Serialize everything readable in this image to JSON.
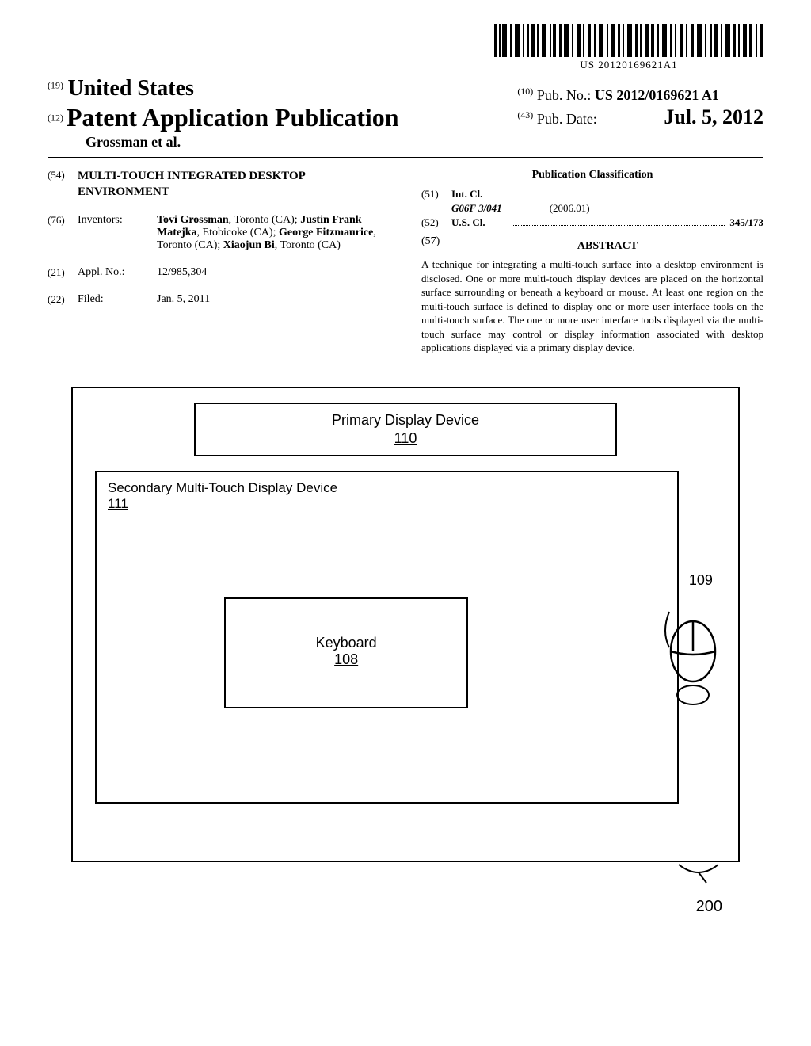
{
  "barcode_number": "US 20120169621A1",
  "header": {
    "country_code": "(19)",
    "country": "United States",
    "doc_type_code": "(12)",
    "doc_type": "Patent Application Publication",
    "authors_line": "Grossman et al.",
    "pub_no_code": "(10)",
    "pub_no_label": "Pub. No.:",
    "pub_no": "US 2012/0169621 A1",
    "pub_date_code": "(43)",
    "pub_date_label": "Pub. Date:",
    "pub_date": "Jul. 5, 2012"
  },
  "left": {
    "title_code": "(54)",
    "title": "MULTI-TOUCH INTEGRATED DESKTOP ENVIRONMENT",
    "inventors_code": "(76)",
    "inventors_label": "Inventors:",
    "inventors_html": "Tovi Grossman, Toronto (CA); Justin Frank Matejka, Etobicoke (CA); George Fitzmaurice, Toronto (CA); Xiaojun Bi, Toronto (CA)",
    "appl_code": "(21)",
    "appl_label": "Appl. No.:",
    "appl_no": "12/985,304",
    "filed_code": "(22)",
    "filed_label": "Filed:",
    "filed_date": "Jan. 5, 2011"
  },
  "right": {
    "classification_hdr": "Publication Classification",
    "intcl_code": "(51)",
    "intcl_label": "Int. Cl.",
    "intcl_class": "G06F 3/041",
    "intcl_date": "(2006.01)",
    "uscl_code": "(52)",
    "uscl_label": "U.S. Cl.",
    "uscl_val": "345/173",
    "abstract_code": "(57)",
    "abstract_hdr": "ABSTRACT",
    "abstract": "A technique for integrating a multi-touch surface into a desktop environment is disclosed. One or more multi-touch display devices are placed on the horizontal surface surrounding or beneath a keyboard or mouse. At least one region on the multi-touch surface is defined to display one or more user interface tools on the multi-touch surface. The one or more user interface tools displayed via the multi-touch surface may control or display information associated with desktop applications displayed via a primary display device."
  },
  "figure": {
    "primary_label": "Primary Display Device",
    "primary_ref": "110",
    "secondary_label": "Secondary Multi-Touch Display Device",
    "secondary_ref": "111",
    "keyboard_label": "Keyboard",
    "keyboard_ref": "108",
    "mouse_ref": "109",
    "fig_ref": "200"
  }
}
